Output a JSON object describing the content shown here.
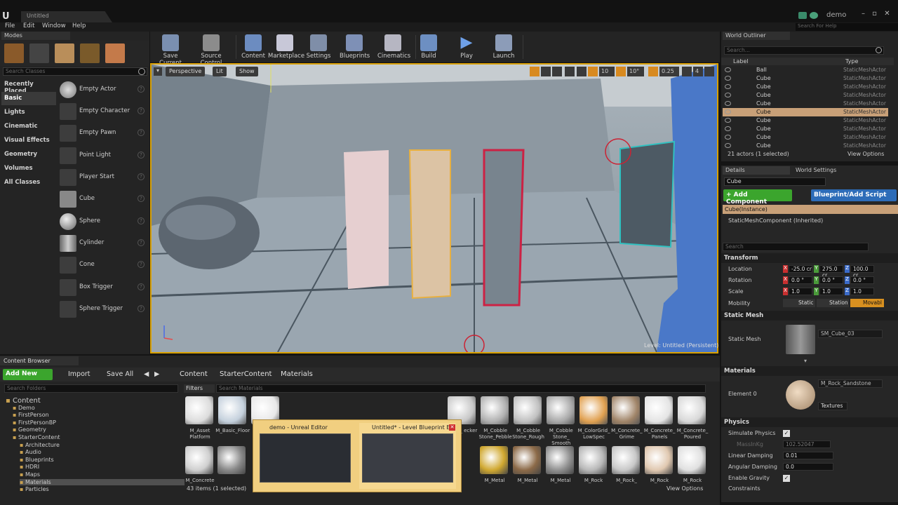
{
  "window": {
    "doc_tab": "Untitled",
    "user": "demo",
    "search_help": "Search For Help"
  },
  "menu": [
    "File",
    "Edit",
    "Window",
    "Help"
  ],
  "modes": {
    "tab": "Modes",
    "search_placeholder": "Search Classes",
    "categories": [
      "Recently Placed",
      "Basic",
      "Lights",
      "Cinematic",
      "Visual Effects",
      "Geometry",
      "Volumes",
      "All Classes"
    ],
    "selected_category": "Basic",
    "items": [
      "Empty Actor",
      "Empty Character",
      "Empty Pawn",
      "Point Light",
      "Player Start",
      "Cube",
      "Sphere",
      "Cylinder",
      "Cone",
      "Box Trigger",
      "Sphere Trigger"
    ]
  },
  "toolbar": [
    "Save Current",
    "Source Control",
    "Content",
    "Marketplace",
    "Settings",
    "Blueprints",
    "Cinematics",
    "Build",
    "Play",
    "Launch"
  ],
  "viewport": {
    "perspective": "Perspective",
    "lit": "Lit",
    "show": "Show",
    "grid_snap": "10",
    "rot_snap": "10°",
    "scale_snap": "0.25",
    "cam_speed": "4",
    "level": "Level:  Untitled (Persistent)"
  },
  "outliner": {
    "tab": "World Outliner",
    "search_placeholder": "Search...",
    "col_label": "Label",
    "col_type": "Type",
    "rows": [
      {
        "label": "Ball",
        "type": "StaticMeshActor"
      },
      {
        "label": "Cube",
        "type": "StaticMeshActor"
      },
      {
        "label": "Cube",
        "type": "StaticMeshActor"
      },
      {
        "label": "Cube",
        "type": "StaticMeshActor"
      },
      {
        "label": "Cube",
        "type": "StaticMeshActor"
      },
      {
        "label": "Cube",
        "type": "StaticMeshActor"
      },
      {
        "label": "Cube",
        "type": "StaticMeshActor"
      },
      {
        "label": "Cube",
        "type": "StaticMeshActor"
      },
      {
        "label": "Cube",
        "type": "StaticMeshActor"
      },
      {
        "label": "Cube",
        "type": "StaticMeshActor"
      }
    ],
    "selected_index": 5,
    "count": "21 actors (1 selected)",
    "view_options": "View Options"
  },
  "details": {
    "tab": "Details",
    "tab2": "World Settings",
    "name": "Cube",
    "add_component": "+ Add Component",
    "blueprint_script": "Blueprint/Add Script",
    "instance": "Cube(Instance)",
    "component": "StaticMeshComponent (Inherited)",
    "search_placeholder": "Search",
    "transform": "Transform",
    "location_label": "Location",
    "location": [
      "-25.0 cr",
      "275.0 cr",
      "100.0 cr"
    ],
    "rotation_label": "Rotation",
    "rotation": [
      "0.0 °",
      "0.0 °",
      "0.0 °"
    ],
    "scale_label": "Scale",
    "scale": [
      "1.0",
      "1.0",
      "1.0"
    ],
    "mobility_label": "Mobility",
    "mobility": [
      "Static",
      "Station",
      "Movabl"
    ],
    "static_mesh_section": "Static Mesh",
    "static_mesh_label": "Static Mesh",
    "static_mesh_value": "SM_Cube_03",
    "materials_section": "Materials",
    "element_label": "Element 0",
    "material_value": "M_Rock_Sandstone",
    "textures": "Textures",
    "physics_section": "Physics",
    "simulate_physics": "Simulate Physics",
    "mass_label": "MassInKg",
    "mass_value": "102.52047",
    "linear_damping_label": "Linear Damping",
    "linear_damping": "0.01",
    "angular_damping_label": "Angular Damping",
    "angular_damping": "0.0",
    "enable_gravity": "Enable Gravity",
    "constraints": "Constraints"
  },
  "content_browser": {
    "tab": "Content Browser",
    "add_new": "Add New",
    "import": "Import",
    "save_all": "Save All",
    "path": [
      "Content",
      "StarterContent",
      "Materials"
    ],
    "folder_search": "Search Folders",
    "folders": [
      "Content",
      "Demo",
      "FirstPerson",
      "FirstPersonBP",
      "Geometry",
      "StarterContent",
      "Architecture",
      "Audio",
      "Blueprints",
      "HDRI",
      "Maps",
      "Materials",
      "Particles"
    ],
    "filters": "Filters",
    "asset_search": "Search Materials",
    "row1": [
      "M_Asset Platform",
      "M_Basic_Floor",
      "",
      "",
      "",
      "",
      "",
      "",
      "amic_ ecker",
      "M_Cobble Stone_Pebble",
      "M_Cobble Stone_Rough",
      "M_Cobble Stone_ Smooth",
      "M_ColorGrid_ LowSpec",
      "M_Concrete_ Grime",
      "M_Concrete_ Panels",
      "M_Concrete_ Poured"
    ],
    "row2": [
      "M_Concrete",
      "",
      "",
      "",
      "",
      "",
      "",
      "M_Metal",
      "M_Metal",
      "M_Metal",
      "M_Rock",
      "M_Rock_",
      "M_Rock",
      "M_Rock"
    ],
    "items_count": "43 items (1 selected)",
    "view_options": "View Options"
  },
  "taskbar_popup": {
    "window1": "demo - Unreal Editor",
    "window2": "Untitled* - Level Blueprint E..."
  },
  "colors": {
    "accent_green": "#3ba52d",
    "accent_blue": "#2d6cb8",
    "selection": "#c8a078",
    "viewport_border": "#d9a000"
  }
}
